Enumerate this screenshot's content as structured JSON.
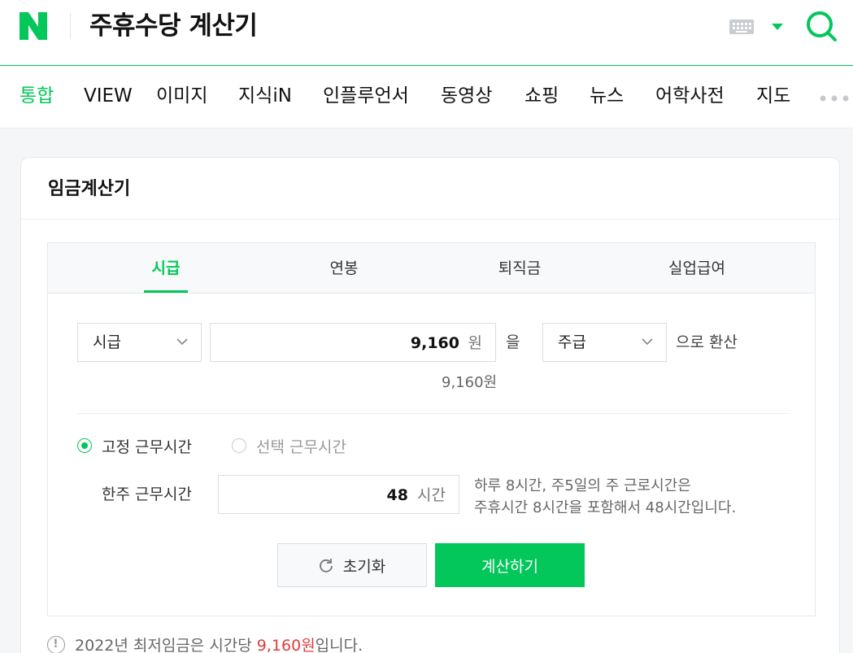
{
  "header": {
    "query": "주휴수당 계산기"
  },
  "nav": {
    "items": [
      "통합",
      "VIEW",
      "이미지",
      "지식iN",
      "인플루언서",
      "동영상",
      "쇼핑",
      "뉴스",
      "어학사전",
      "지도"
    ],
    "active": "통합"
  },
  "card": {
    "title": "임금계산기",
    "tabs": [
      "시급",
      "연봉",
      "퇴직금",
      "실업급여"
    ],
    "active_tab": "시급",
    "from_select": "시급",
    "amount_value": "9,160",
    "amount_unit": "원",
    "particle": "을",
    "to_select": "주급",
    "convert_suffix": "으로 환산",
    "converted_text": "9,160원",
    "radio_fixed": "고정 근무시간",
    "radio_select": "선택 근무시간",
    "hours_label": "한주 근무시간",
    "hours_value": "48",
    "hours_unit": "시간",
    "hint_line1": "하루 8시간, 주5일의 주 근로시간은",
    "hint_line2": "주휴시간 8시간을 포함해서 48시간입니다.",
    "reset_label": "초기화",
    "calc_label": "계산하기"
  },
  "notice": {
    "prefix": "2022년 최저임금은 시간당 ",
    "highlight": "9,160원",
    "suffix": "입니다."
  },
  "colors": {
    "brand_green": "#03c75a",
    "highlight_red": "#e03c3c"
  },
  "icons": [
    "naver-logo-icon",
    "keyboard-icon",
    "dropdown-caret-icon",
    "search-icon",
    "more-dots-icon",
    "chevron-down-icon",
    "refresh-icon",
    "info-icon"
  ]
}
